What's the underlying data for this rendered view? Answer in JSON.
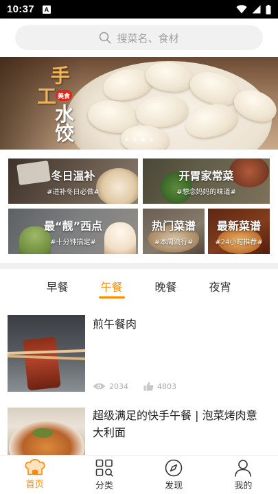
{
  "status_bar": {
    "time": "10:37",
    "notification_badge": "A",
    "icons": [
      "wifi-icon",
      "signal-icon",
      "battery-icon"
    ]
  },
  "search": {
    "placeholder": "搜菜名、食材",
    "icon": "search-icon"
  },
  "banner": {
    "title_chars": [
      "手",
      "工",
      "水",
      "饺"
    ],
    "tag": "美食",
    "dot_count": 4,
    "active_dot": 2
  },
  "categories": [
    {
      "title": "冬日温补",
      "subtitle": "#进补冬日必做#"
    },
    {
      "title": "开胃家常菜",
      "subtitle": "#想念妈妈的味道#"
    },
    {
      "title": "最“靓”西点",
      "subtitle": "#十分钟搞定#"
    },
    {
      "title": "热门菜谱",
      "subtitle": "#本周流行#"
    },
    {
      "title": "最新菜谱",
      "subtitle": "#24小时推荐#"
    }
  ],
  "meal_tabs": {
    "items": [
      "早餐",
      "午餐",
      "晚餐",
      "夜宵"
    ],
    "active": "午餐"
  },
  "recipes": [
    {
      "title": "煎午餐肉",
      "views": "2034",
      "likes": "4803"
    },
    {
      "title": "超级满足的快手午餐 | 泡菜烤肉意大利面"
    }
  ],
  "bottom_nav": {
    "items": [
      {
        "label": "首页",
        "icon": "home-chef-hat-icon",
        "active": true
      },
      {
        "label": "分类",
        "icon": "category-grid-icon",
        "active": false
      },
      {
        "label": "发现",
        "icon": "compass-icon",
        "active": false
      },
      {
        "label": "我的",
        "icon": "profile-icon",
        "active": false
      }
    ]
  },
  "colors": {
    "accent": "#ff8a00",
    "tag_red": "#e0261b",
    "search_bg": "#f1f1f1"
  }
}
